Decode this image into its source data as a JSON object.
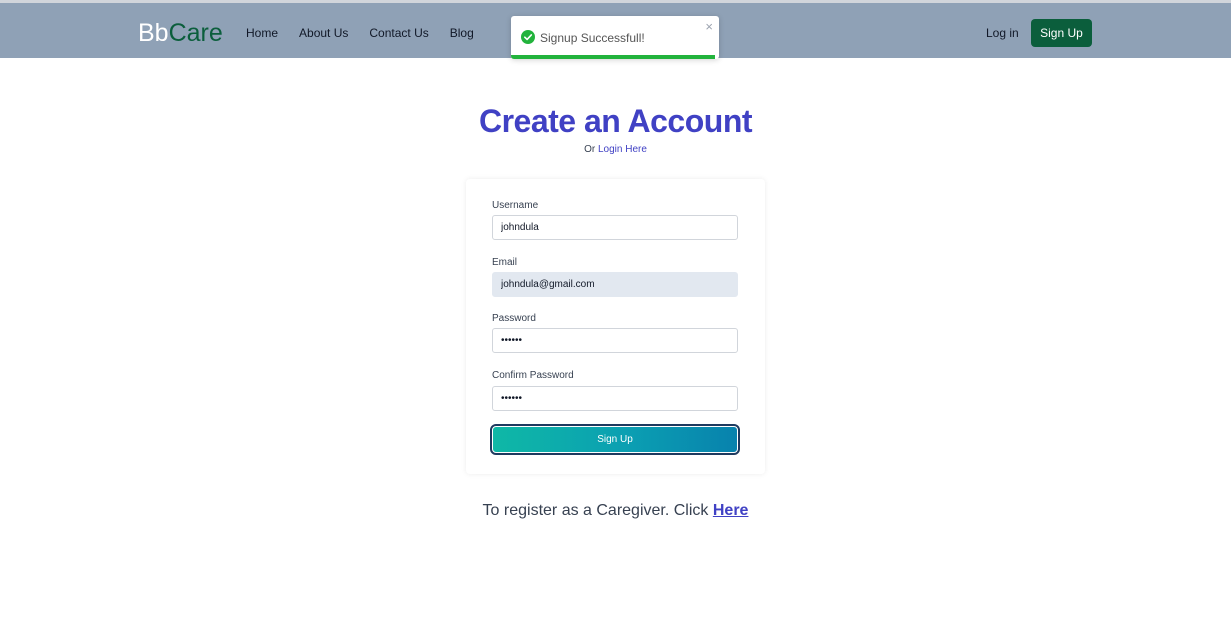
{
  "navbar": {
    "brand_bb": "Bb",
    "brand_care": "Care",
    "links": [
      "Home",
      "About Us",
      "Contact Us",
      "Blog"
    ],
    "login_label": "Log in",
    "signup_label": "Sign Up"
  },
  "toast": {
    "message": "Signup Successfull!",
    "close_glyph": "×",
    "progress": 0.98
  },
  "page": {
    "title": "Create an Account",
    "subtitle_prefix": "Or",
    "subtitle_link": "Login Here"
  },
  "form": {
    "username_label": "Username",
    "username_value": "johndula",
    "email_label": "Email",
    "email_value": "johndula@gmail.com",
    "password_label": "Password",
    "password_value": "••••••",
    "confirm_label": "Confirm Password",
    "confirm_value": "••••••",
    "submit_label": "Sign Up"
  },
  "footer": {
    "text": "To register as a Caregiver. Click",
    "link": "Here"
  },
  "colors": {
    "navbar_bg": "#8fa1b6",
    "brand_green": "#0b5e3c",
    "accent_blue": "#4041c4",
    "success_green": "#22b33c"
  }
}
